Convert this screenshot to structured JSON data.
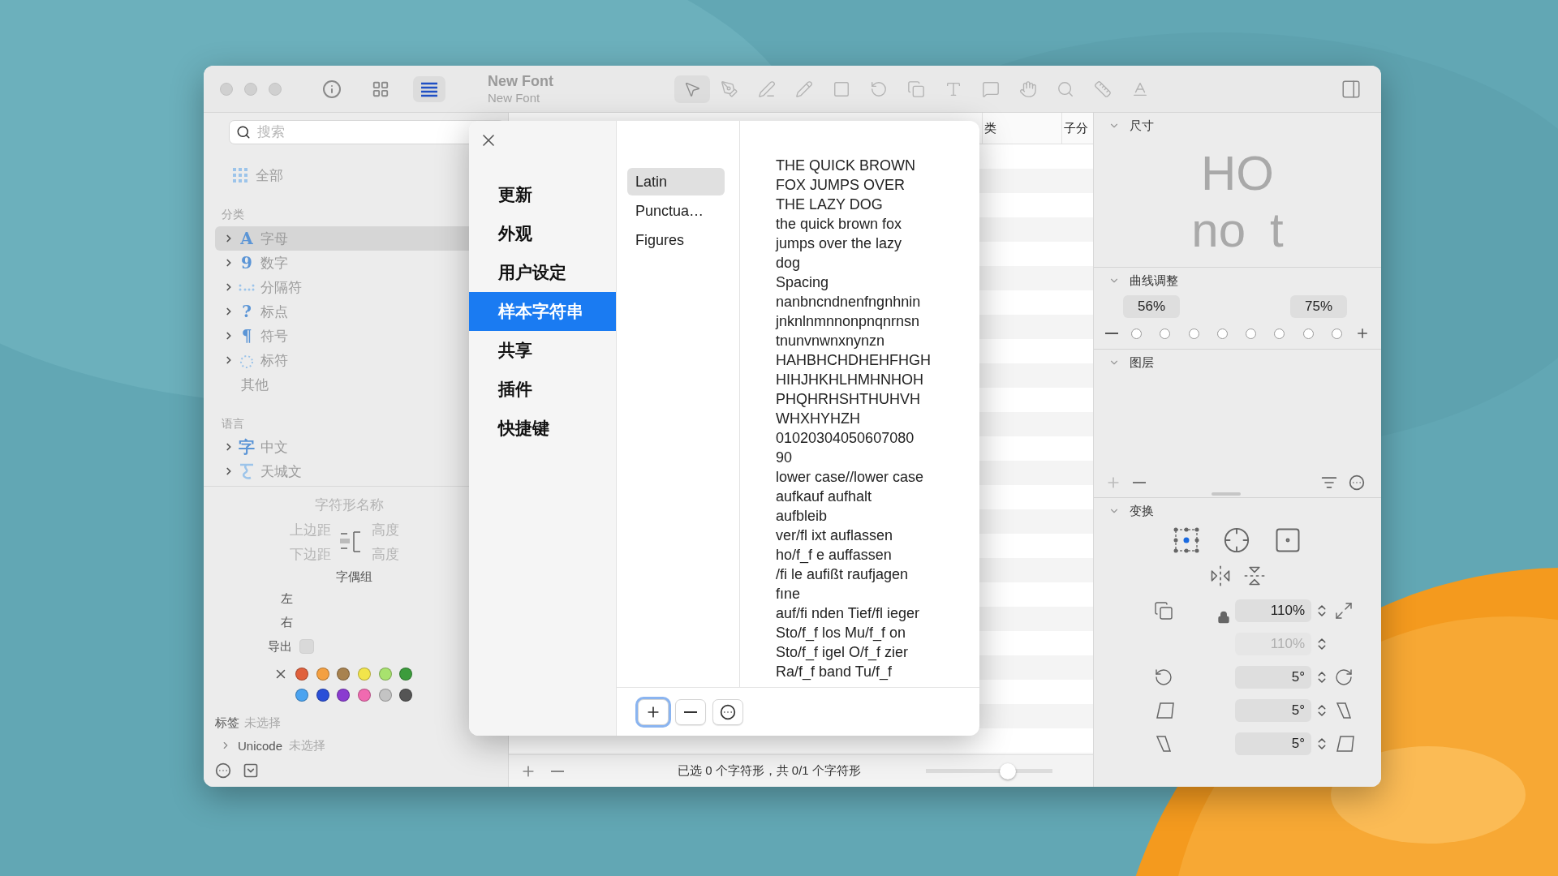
{
  "window": {
    "title": "New Font",
    "subtitle": "New Font"
  },
  "view_buttons": [
    {
      "kind": "info",
      "selected": false
    },
    {
      "kind": "grid",
      "selected": false
    },
    {
      "kind": "list",
      "selected": true
    }
  ],
  "tools": [
    {
      "kind": "pointer",
      "selected": true
    },
    {
      "kind": "pen",
      "selected": false
    },
    {
      "kind": "brush",
      "selected": false
    },
    {
      "kind": "pencil",
      "selected": false
    },
    {
      "kind": "rectangle",
      "selected": false
    },
    {
      "kind": "rotate",
      "selected": false
    },
    {
      "kind": "scale",
      "selected": false
    },
    {
      "kind": "text",
      "selected": false
    },
    {
      "kind": "annotation",
      "selected": false
    },
    {
      "kind": "hand",
      "selected": false
    },
    {
      "kind": "zoom",
      "selected": false
    },
    {
      "kind": "measure",
      "selected": false
    },
    {
      "kind": "baseline",
      "selected": false
    }
  ],
  "sidebar": {
    "search": {
      "placeholder": "搜索"
    },
    "all": "全部",
    "sections": [
      {
        "heading": "分类",
        "items": [
          {
            "label": "字母",
            "kind": "letter",
            "glyph": "A",
            "selected": true
          },
          {
            "label": "数字",
            "kind": "number",
            "glyph": "9",
            "selected": false
          },
          {
            "label": "分隔符",
            "kind": "separator",
            "selected": false
          },
          {
            "label": "标点",
            "kind": "punctuation",
            "glyph": "?",
            "selected": false
          },
          {
            "label": "符号",
            "kind": "symbol",
            "glyph": "¶",
            "selected": false
          },
          {
            "label": "标符",
            "kind": "mark",
            "selected": false
          },
          {
            "label": "其他",
            "kind": "other",
            "selected": false
          }
        ]
      },
      {
        "heading": "语言",
        "items": [
          {
            "label": "中文",
            "kind": "han",
            "glyph": "字",
            "selected": false
          },
          {
            "label": "天城文",
            "kind": "devanagari",
            "selected": false
          }
        ]
      }
    ],
    "glyph_info": {
      "name_label": "字符形名称",
      "metrics": [
        {
          "label": "上边距",
          "value_label": "高度"
        },
        {
          "label": "下边距",
          "value_label": "高度"
        }
      ],
      "kerning_label": "字偶组",
      "kerning": [
        "左",
        "右"
      ],
      "export": {
        "label": "导出",
        "checked": false
      },
      "colors": [
        {
          "color": "#e0603c"
        },
        {
          "color": "#f4a041"
        },
        {
          "color": "#a8824f"
        },
        {
          "color": "#f2e54b"
        },
        {
          "color": "#a8e26e"
        },
        {
          "color": "#3c9c3c"
        },
        {
          "color": "#4aa3f0"
        },
        {
          "color": "#2a4fd8"
        },
        {
          "color": "#8a3cd0"
        },
        {
          "color": "#f06ab0"
        },
        {
          "color": "#c4c4c4"
        },
        {
          "color": "#555555"
        }
      ],
      "tags": {
        "label": "标签",
        "value": "未选择"
      },
      "unicode": {
        "label": "Unicode",
        "value": "未选择"
      }
    }
  },
  "table": {
    "columns": [
      "类",
      "子分"
    ]
  },
  "status_bar": {
    "text": "已选 0 个字符形，共 0/1 个字符形",
    "zoom": {
      "level": 0.65
    }
  },
  "inspector": {
    "sections": [
      {
        "kind": "dimensions",
        "title": "尺寸",
        "preview": [
          "HO",
          "no",
          "t"
        ]
      },
      {
        "kind": "curves",
        "title": "曲线调整",
        "fields": [
          "56%",
          "75%"
        ]
      },
      {
        "kind": "layers",
        "title": "图层"
      },
      {
        "kind": "transform",
        "title": "变换",
        "scale": [
          {
            "value": "110%",
            "disabled": false
          },
          {
            "value": "110%",
            "disabled": true
          }
        ],
        "rotate": "5°",
        "slant": [
          "5°",
          "5°"
        ]
      }
    ]
  },
  "dialog": {
    "menu": [
      {
        "label": "更新",
        "selected": false
      },
      {
        "label": "外观",
        "selected": false
      },
      {
        "label": "用户设定",
        "selected": false
      },
      {
        "label": "样本字符串",
        "selected": true
      },
      {
        "label": "共享",
        "selected": false
      },
      {
        "label": "插件",
        "selected": false
      },
      {
        "label": "快捷键",
        "selected": false
      }
    ],
    "categories": [
      {
        "label": "Latin",
        "selected": true
      },
      {
        "label": "Punctua…",
        "selected": false
      },
      {
        "label": "Figures",
        "selected": false
      }
    ],
    "sample_lines": [
      "THE QUICK BROWN",
      "FOX JUMPS OVER",
      "THE LAZY DOG",
      "the quick brown fox",
      "jumps over the lazy",
      "dog",
      "Spacing",
      "nanbncndnenfngnhnin",
      "jnknlnmnnonpnqnrnsn",
      "tnunvnwnxnynzn",
      "HAHBHCHDHEHFHGH",
      "HIHJHKHLHMHNHOH",
      "PHQHRHSHTHUHVH",
      "WHXHYHZH",
      "01020304050607080",
      "90",
      "lower case//lower case",
      "aufkauf aufhalt",
      "aufbleib",
      "ver/fl ixt auflassen",
      "ho/f_f e auffassen",
      "/fi le aufißt raufjagen",
      "fıne",
      "auf/fi nden Tief/fl ieger",
      "Sto/f_f los Mu/f_f on",
      "Sto/f_f igel O/f_f zier",
      "Ra/f_f band Tu/f_f"
    ],
    "buttons": [
      {
        "kind": "add",
        "focused": true
      },
      {
        "kind": "remove",
        "focused": false
      },
      {
        "kind": "more",
        "focused": false
      }
    ]
  }
}
